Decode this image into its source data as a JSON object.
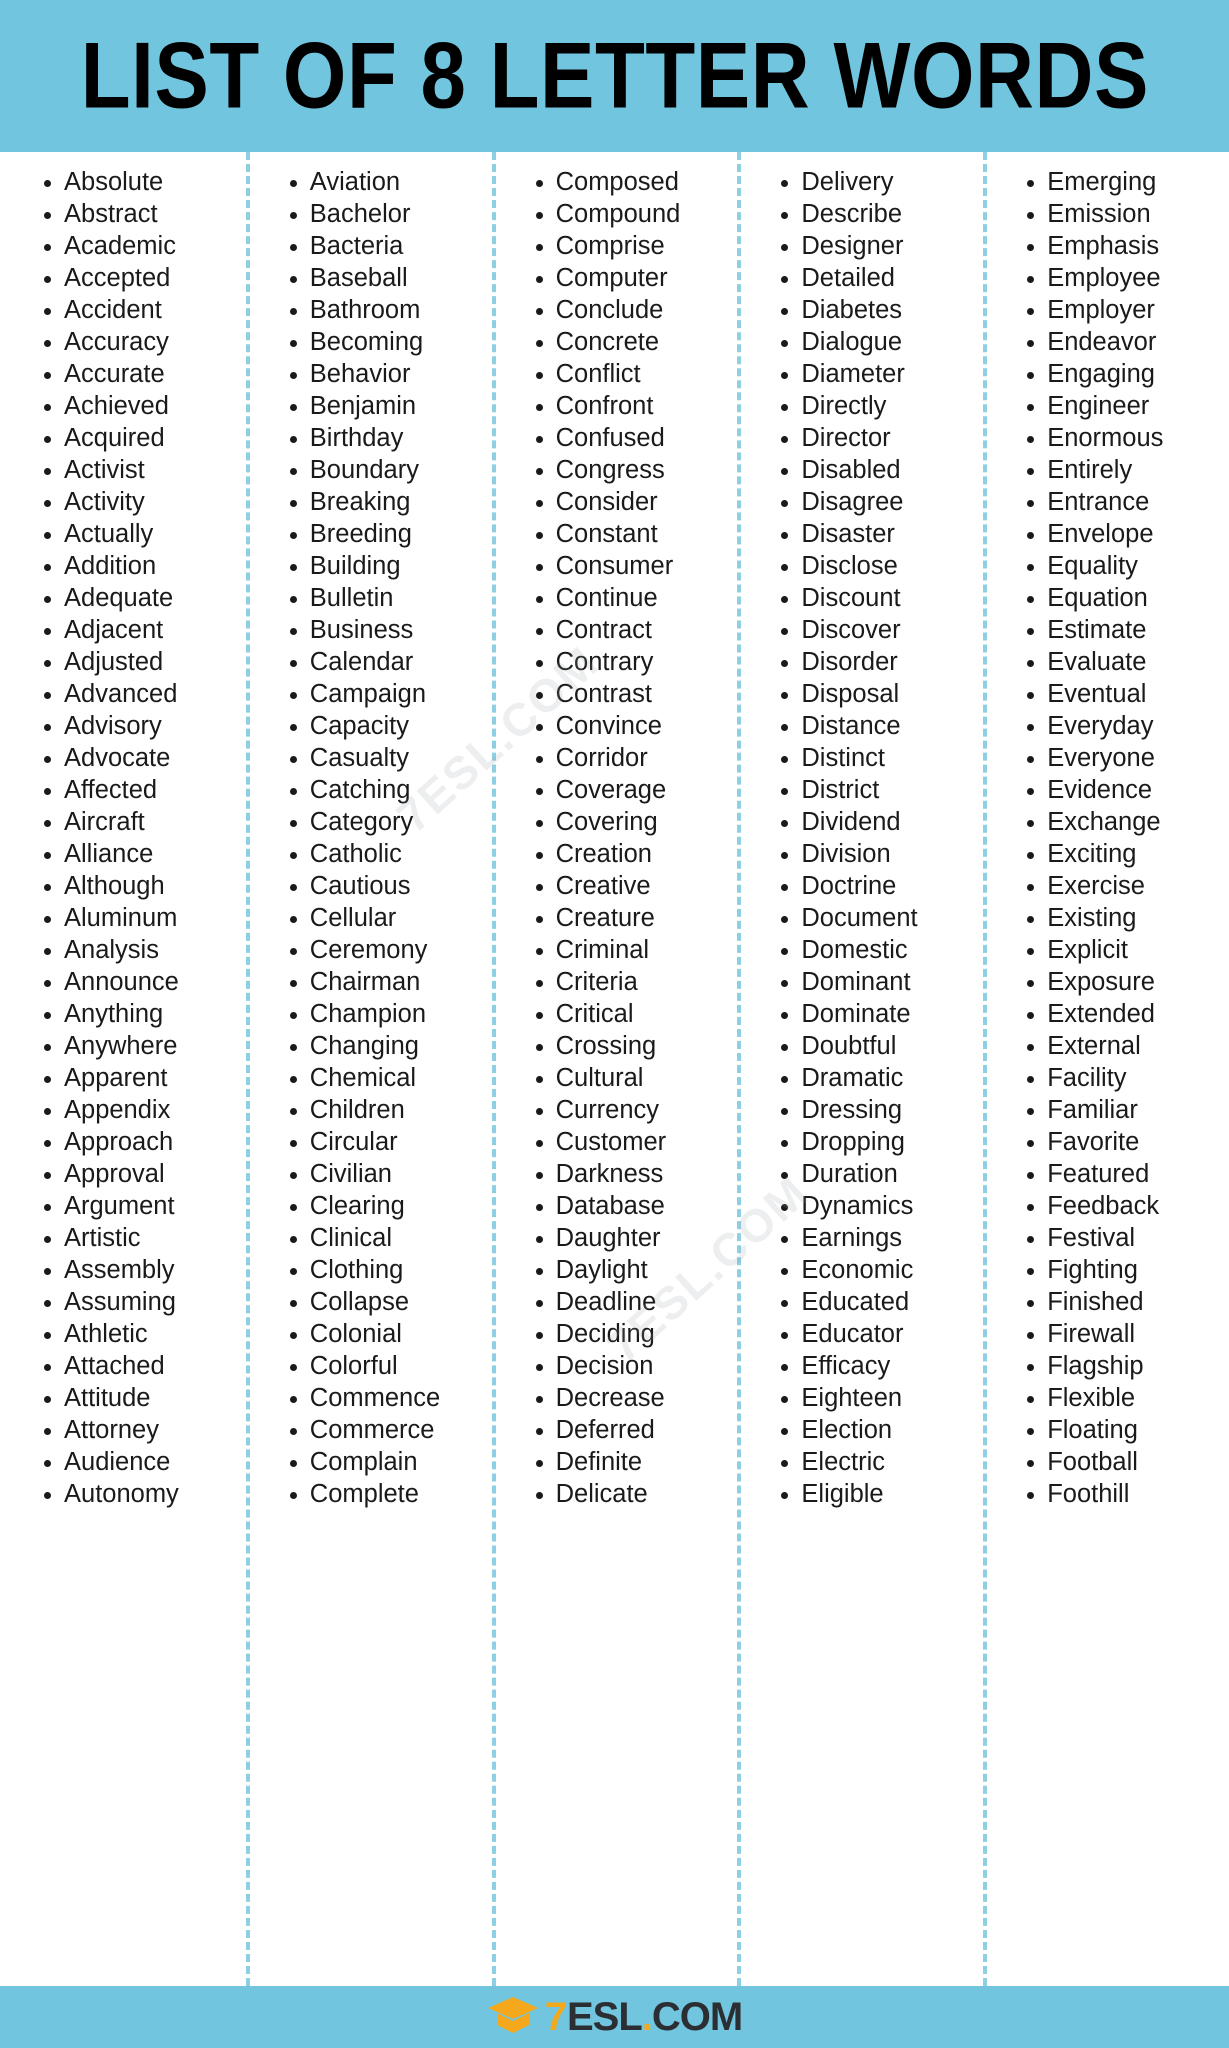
{
  "header": {
    "title": "LIST OF 8 LETTER WORDS",
    "background_color": "#71c5de"
  },
  "footer": {
    "background_color": "#71c5de",
    "logo": {
      "icon": "graduation-cap-icon",
      "icon_color": "#f5a81c",
      "prefix": "7",
      "name": "ESL",
      "dot": ".",
      "tld": "COM",
      "full_text": "7ESL.COM"
    }
  },
  "watermarks": [
    {
      "text": "7ESL.COM"
    },
    {
      "text": "7ESL.COM"
    }
  ],
  "divider_color": "#8ecfe3",
  "bullet_color": "#1a1a1a",
  "columns": [
    {
      "id": "column-1",
      "words": [
        "Absolute",
        "Abstract",
        "Academic",
        "Accepted",
        "Accident",
        "Accuracy",
        "Accurate",
        "Achieved",
        "Acquired",
        "Activist",
        "Activity",
        "Actually",
        "Addition",
        "Adequate",
        "Adjacent",
        "Adjusted",
        "Advanced",
        "Advisory",
        "Advocate",
        "Affected",
        "Aircraft",
        "Alliance",
        "Although",
        "Aluminum",
        "Analysis",
        "Announce",
        "Anything",
        "Anywhere",
        "Apparent",
        "Appendix",
        "Approach",
        "Approval",
        "Argument",
        "Artistic",
        "Assembly",
        "Assuming",
        "Athletic",
        "Attached",
        "Attitude",
        "Attorney",
        "Audience",
        "Autonomy"
      ]
    },
    {
      "id": "column-2",
      "words": [
        "Aviation",
        "Bachelor",
        "Bacteria",
        "Baseball",
        "Bathroom",
        "Becoming",
        "Behavior",
        "Benjamin",
        "Birthday",
        "Boundary",
        "Breaking",
        "Breeding",
        "Building",
        "Bulletin",
        "Business",
        "Calendar",
        "Campaign",
        "Capacity",
        "Casualty",
        "Catching",
        "Category",
        "Catholic",
        "Cautious",
        "Cellular",
        "Ceremony",
        "Chairman",
        "Champion",
        "Changing",
        "Chemical",
        "Children",
        "Circular",
        "Civilian",
        "Clearing",
        "Clinical",
        "Clothing",
        "Collapse",
        "Colonial",
        "Colorful",
        "Commence",
        "Commerce",
        "Complain",
        "Complete"
      ]
    },
    {
      "id": "column-3",
      "words": [
        "Composed",
        "Compound",
        "Comprise",
        "Computer",
        "Conclude",
        "Concrete",
        "Conflict",
        "Confront",
        "Confused",
        "Congress",
        "Consider",
        "Constant",
        "Consumer",
        "Continue",
        "Contract",
        "Contrary",
        "Contrast",
        "Convince",
        "Corridor",
        "Coverage",
        "Covering",
        "Creation",
        "Creative",
        "Creature",
        "Criminal",
        "Criteria",
        "Critical",
        "Crossing",
        "Cultural",
        "Currency",
        "Customer",
        "Darkness",
        "Database",
        "Daughter",
        "Daylight",
        "Deadline",
        "Deciding",
        "Decision",
        "Decrease",
        "Deferred",
        "Definite",
        "Delicate"
      ]
    },
    {
      "id": "column-4",
      "words": [
        "Delivery",
        "Describe",
        "Designer",
        "Detailed",
        "Diabetes",
        "Dialogue",
        "Diameter",
        "Directly",
        "Director",
        "Disabled",
        "Disagree",
        "Disaster",
        "Disclose",
        "Discount",
        "Discover",
        "Disorder",
        "Disposal",
        "Distance",
        "Distinct",
        "District",
        "Dividend",
        "Division",
        "Doctrine",
        "Document",
        "Domestic",
        "Dominant",
        "Dominate",
        "Doubtful",
        "Dramatic",
        "Dressing",
        "Dropping",
        "Duration",
        "Dynamics",
        "Earnings",
        "Economic",
        "Educated",
        "Educator",
        "Efficacy",
        "Eighteen",
        "Election",
        "Electric",
        "Eligible"
      ]
    },
    {
      "id": "column-5",
      "words": [
        "Emerging",
        "Emission",
        "Emphasis",
        "Employee",
        "Employer",
        "Endeavor",
        "Engaging",
        "Engineer",
        "Enormous",
        "Entirely",
        "Entrance",
        "Envelope",
        "Equality",
        "Equation",
        "Estimate",
        "Evaluate",
        "Eventual",
        "Everyday",
        "Everyone",
        "Evidence",
        "Exchange",
        "Exciting",
        "Exercise",
        "Existing",
        "Explicit",
        "Exposure",
        "Extended",
        "External",
        "Facility",
        "Familiar",
        "Favorite",
        "Featured",
        "Feedback",
        "Festival",
        "Fighting",
        "Finished",
        "Firewall",
        "Flagship",
        "Flexible",
        "Floating",
        "Football",
        "Foothill"
      ]
    }
  ]
}
